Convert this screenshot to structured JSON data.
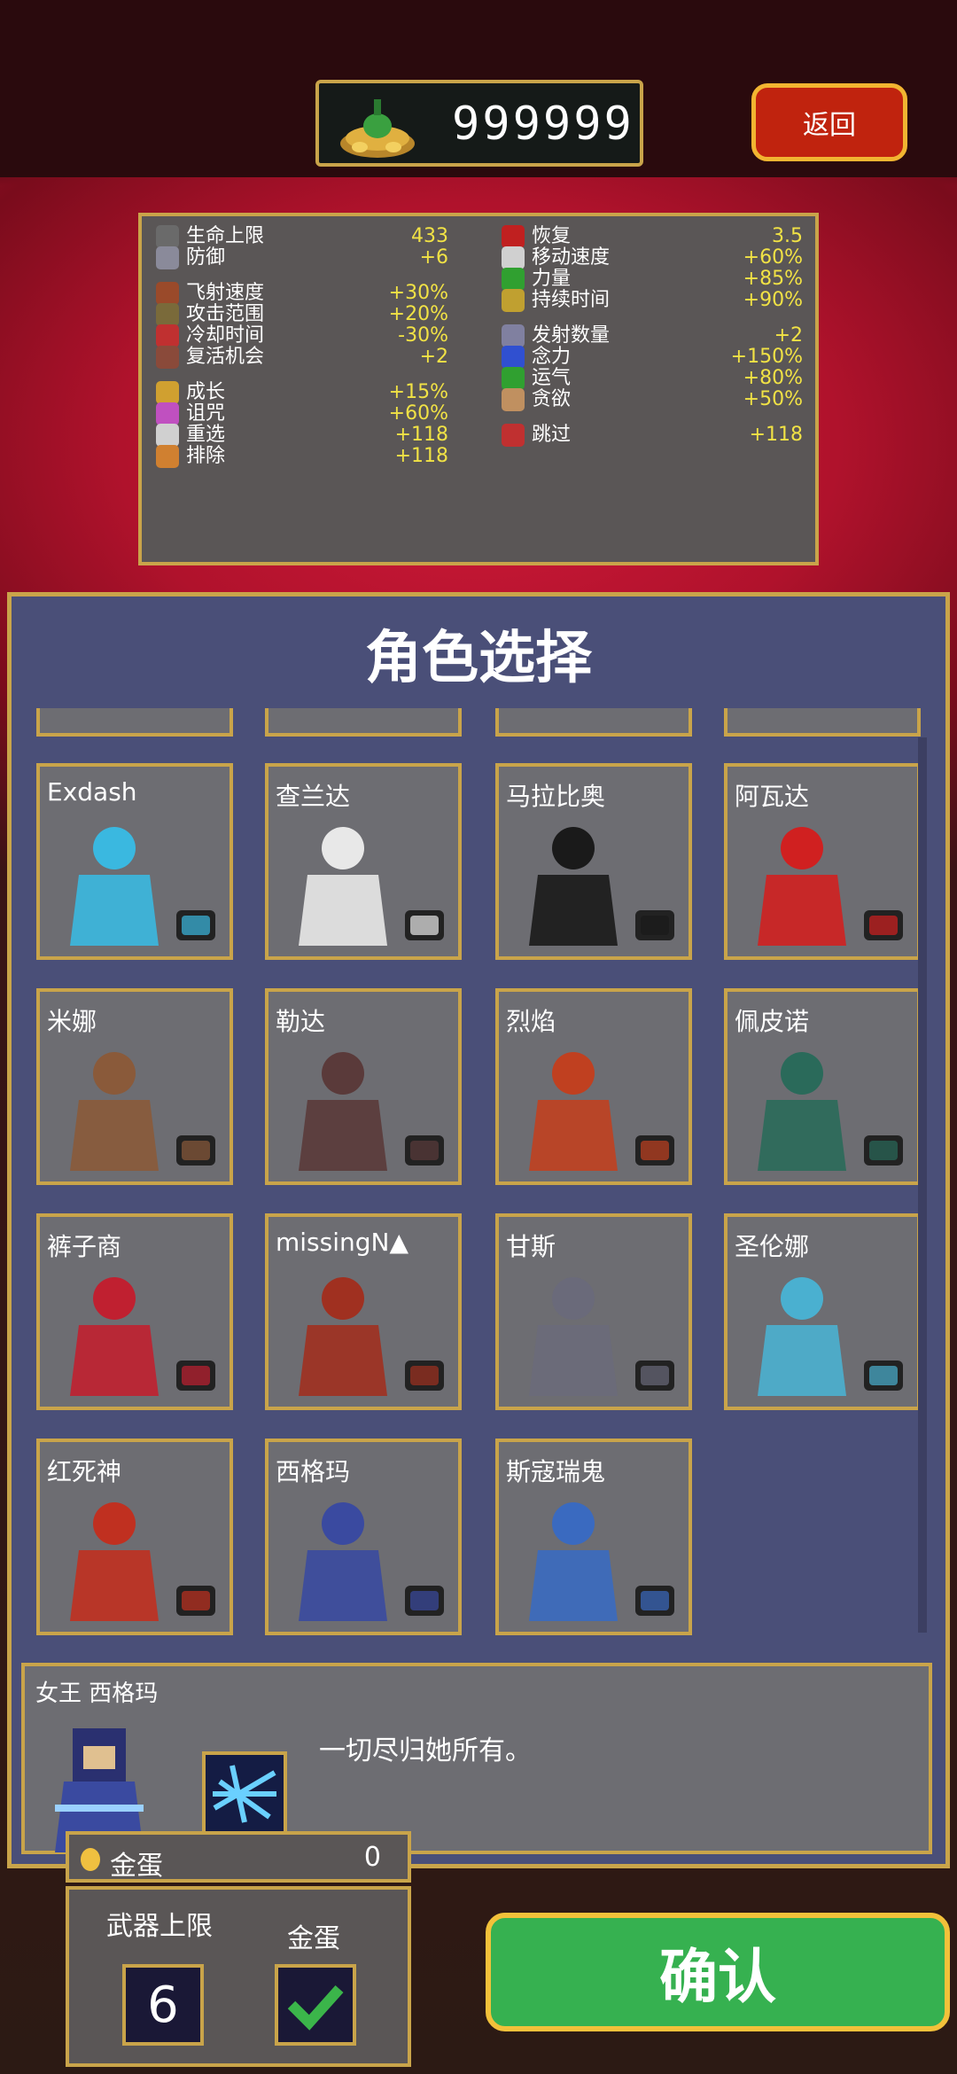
{
  "currency": {
    "amount": "999999",
    "icon": "gold-coin-pile-icon"
  },
  "header": {
    "back_label": "返回"
  },
  "stats": {
    "left": [
      {
        "label": "生命上限",
        "value": "433",
        "icon": "heart-icon",
        "color": "#6a6a6a"
      },
      {
        "label": "防御",
        "value": "+6",
        "icon": "armor-icon",
        "color": "#8a8a9a"
      },
      {
        "label": "飞射速度",
        "value": "+30%",
        "icon": "bracer-icon",
        "color": "#9a4a2a"
      },
      {
        "label": "攻击范围",
        "value": "+20%",
        "icon": "candelabra-icon",
        "color": "#7a6a3a"
      },
      {
        "label": "冷却时间",
        "value": "-30%",
        "icon": "clock-icon",
        "color": "#c03030"
      },
      {
        "label": "复活机会",
        "value": "+2",
        "icon": "tiragisu-icon",
        "color": "#8a4a3a"
      },
      {
        "label": "成长",
        "value": "+15%",
        "icon": "crown-icon",
        "color": "#d0a030"
      },
      {
        "label": "诅咒",
        "value": "+60%",
        "icon": "skull-icon",
        "color": "#c050c0"
      },
      {
        "label": "重选",
        "value": "+118",
        "icon": "reroll-icon",
        "color": "#d0d0d0"
      },
      {
        "label": "排除",
        "value": "+118",
        "icon": "banish-icon",
        "color": "#d08030"
      }
    ],
    "right": [
      {
        "label": "恢复",
        "value": "3.5",
        "icon": "pummarola-icon",
        "color": "#c02020"
      },
      {
        "label": "移动速度",
        "value": "+60%",
        "icon": "wings-icon",
        "color": "#d0d0d0"
      },
      {
        "label": "力量",
        "value": "+85%",
        "icon": "spinach-icon",
        "color": "#30a030"
      },
      {
        "label": "持续时间",
        "value": "+90%",
        "icon": "spellbinder-icon",
        "color": "#c0a030"
      },
      {
        "label": "发射数量",
        "value": "+2",
        "icon": "duplicator-icon",
        "color": "#8080a0"
      },
      {
        "label": "念力",
        "value": "+150%",
        "icon": "attractorb-icon",
        "color": "#3050d0"
      },
      {
        "label": "运气",
        "value": "+80%",
        "icon": "clover-icon",
        "color": "#30a030"
      },
      {
        "label": "贪欲",
        "value": "+50%",
        "icon": "stone-mask-icon",
        "color": "#c09060"
      },
      {
        "label": "跳过",
        "value": "+118",
        "icon": "skip-icon",
        "color": "#c03030"
      }
    ]
  },
  "character_select": {
    "title": "角色选择",
    "characters": [
      {
        "name": "Exdash",
        "color": "#3ab8e0"
      },
      {
        "name": "查兰达",
        "color": "#e8e8e8"
      },
      {
        "name": "马拉比奥",
        "color": "#1a1a1a"
      },
      {
        "name": "阿瓦达",
        "color": "#d02020"
      },
      {
        "name": "米娜",
        "color": "#8a5a3a"
      },
      {
        "name": "勒达",
        "color": "#5a3a3a"
      },
      {
        "name": "烈焰",
        "color": "#c04020"
      },
      {
        "name": "佩皮诺",
        "color": "#2a6a5a"
      },
      {
        "name": "裤子商",
        "color": "#c02030"
      },
      {
        "name": "missingN▲",
        "color": "#a03020"
      },
      {
        "name": "甘斯",
        "color": "#6a6a7a"
      },
      {
        "name": "圣伦娜",
        "color": "#4ab0d0"
      },
      {
        "name": "红死神",
        "color": "#c03020"
      },
      {
        "name": "西格玛",
        "color": "#3a4aa0"
      },
      {
        "name": "斯寇瑞鬼",
        "color": "#3a6ac0"
      }
    ]
  },
  "selected": {
    "title": "女王 西格玛",
    "description": "一切尽归她所有。"
  },
  "options": {
    "egg_label": "金蛋",
    "egg_count": "0",
    "weapon_limit_label": "武器上限",
    "weapon_limit_value": "6",
    "egg_toggle_label": "金蛋",
    "egg_toggle_checked": true
  },
  "confirm_label": "确认"
}
